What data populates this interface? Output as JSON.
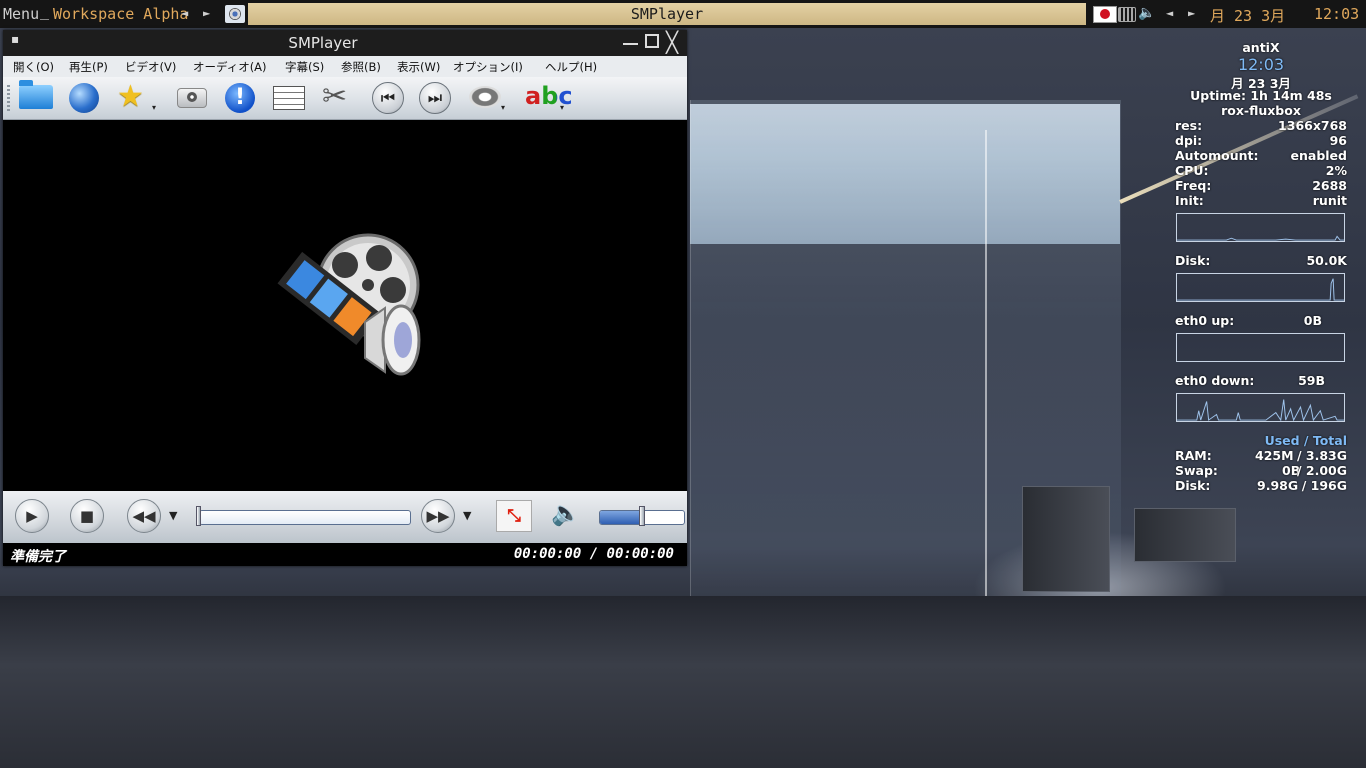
{
  "panel": {
    "menu_label": "Menu",
    "menu_separator": "_",
    "workspace": "Workspace Alpha",
    "ws_prev": "◄",
    "ws_next": "►",
    "active_task": "SMPlayer",
    "cal_prev": "◄",
    "cal_next": "►",
    "date": "月 23  3月",
    "clock": "12:03"
  },
  "window": {
    "menu_icon": "▪",
    "title": "SMPlayer",
    "close_glyph": "╳",
    "menus": [
      {
        "label": "開く(O)"
      },
      {
        "label": "再生(P)"
      },
      {
        "label": "ビデオ(V)"
      },
      {
        "label": "オーディオ(A)"
      },
      {
        "label": "字幕(S)"
      },
      {
        "label": "参照(B)"
      },
      {
        "label": "表示(W)"
      },
      {
        "label": "オプション(I)"
      },
      {
        "label": "ヘルプ(H)"
      }
    ],
    "toolbar_icons": [
      "open-folder-icon",
      "web-globe-icon",
      "favorites-star-icon",
      "screenshot-camera-icon",
      "info-icon",
      "playlist-icon",
      "preferences-tools-icon",
      "previous-chapter-icon",
      "next-chapter-icon",
      "dvd-disc-icon",
      "subtitles-abc-icon"
    ],
    "glyphs": {
      "star": "★",
      "info": "!",
      "prefs": "✂",
      "prev": "⏮",
      "next": "⏭",
      "sub": "abc",
      "dropdown": "▾",
      "play": "▶",
      "stop": "■",
      "rew": "◀◀",
      "ff": "▶▶",
      "menu_arrow": "▼",
      "fullscreen": "⤡",
      "mute": "🔈"
    },
    "status": {
      "text": "準備完了",
      "time": "00:00:00 / 00:00:00"
    },
    "volume_level": 0.52,
    "seek_position": 0.0
  },
  "conky": {
    "host": "antiX",
    "time": "12:03",
    "date": "月 23  3月",
    "uptime": "Uptime: 1h 14m 48s",
    "wm": "rox-fluxbox",
    "rows": [
      {
        "label": "res:",
        "value": "1366x768"
      },
      {
        "label": "dpi:",
        "value": "96"
      },
      {
        "label": "Automount:",
        "value": "enabled"
      },
      {
        "label": "CPU:",
        "value": "2%"
      },
      {
        "label": "Freq:",
        "value": "2688"
      },
      {
        "label": "Init:",
        "value": "runit"
      }
    ],
    "disk_label": "Disk:",
    "disk_value": "50.0K",
    "eth_up_label": "eth0 up:",
    "eth_up_value": "0B",
    "eth_down_label": "eth0 down:",
    "eth_down_value": "59B",
    "used_total": "Used / Total",
    "mem": [
      {
        "label": "RAM:",
        "used": "425M",
        "total": "/ 3.83G"
      },
      {
        "label": "Swap:",
        "used": "0B",
        "total": "/ 2.00G"
      },
      {
        "label": "Disk:",
        "used": "9.98G",
        "total": "/ 196G"
      }
    ]
  },
  "colors": {
    "panel_bg": "#151515",
    "panel_accent": "#e0a85c",
    "task_bg": "#d9c594",
    "conky_accent": "#7fbaf5"
  }
}
